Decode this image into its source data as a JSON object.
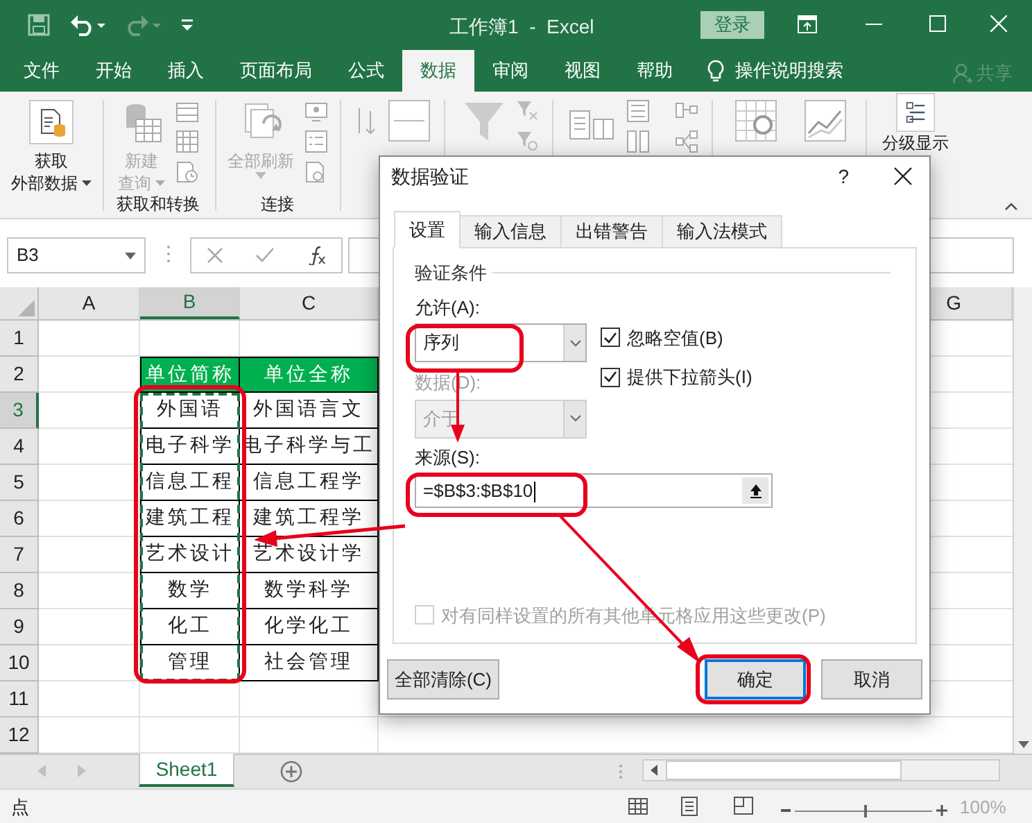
{
  "window": {
    "title": "工作簿1  -  Excel",
    "sign_in": "登录"
  },
  "ribbon_tabs": [
    {
      "label": "文件",
      "selected": false
    },
    {
      "label": "开始",
      "selected": false
    },
    {
      "label": "插入",
      "selected": false
    },
    {
      "label": "页面布局",
      "selected": false
    },
    {
      "label": "公式",
      "selected": false
    },
    {
      "label": "数据",
      "selected": true
    },
    {
      "label": "审阅",
      "selected": false
    },
    {
      "label": "视图",
      "selected": false
    },
    {
      "label": "帮助",
      "selected": false
    }
  ],
  "tell_me": "操作说明搜索",
  "share": "共享",
  "ribbon": {
    "get_external": [
      "获取",
      "外部数据"
    ],
    "new_query": [
      "新建",
      "查询"
    ],
    "refresh_all": "全部刷新",
    "groups": [
      "获取和转换",
      "连接"
    ],
    "outline": "分级显示"
  },
  "name_box": "B3",
  "columns": [
    "A",
    "B",
    "C",
    "G"
  ],
  "row_headers": [
    "1",
    "2",
    "3",
    "4",
    "5",
    "6",
    "7",
    "8",
    "9",
    "10",
    "11",
    "12"
  ],
  "table": {
    "header": [
      "单位简称",
      "单位全称"
    ],
    "rows": [
      [
        "外国语",
        "外国语言文"
      ],
      [
        "电子科学",
        "电子科学与工"
      ],
      [
        "信息工程",
        "信息工程学"
      ],
      [
        "建筑工程",
        "建筑工程学"
      ],
      [
        "艺术设计",
        "艺术设计学"
      ],
      [
        "数学",
        "数学科学"
      ],
      [
        "化工",
        "化学化工"
      ],
      [
        "管理",
        "社会管理"
      ]
    ]
  },
  "sheet_tabs": [
    {
      "label": "Sheet1",
      "selected": true
    }
  ],
  "status": {
    "mode": "点",
    "zoom": "100%",
    "zoom_slider": {
      "level": 0.5
    }
  },
  "dialog": {
    "title": "数据验证",
    "help": "?",
    "tabs": [
      {
        "label": "设置",
        "selected": true
      },
      {
        "label": "输入信息",
        "selected": false
      },
      {
        "label": "出错警告",
        "selected": false
      },
      {
        "label": "输入法模式",
        "selected": false
      }
    ],
    "section": "验证条件",
    "allow": {
      "label": "允许(A):",
      "value": "序列",
      "disabled": false
    },
    "data": {
      "label": "数据(D):",
      "value": "介于",
      "disabled": true
    },
    "checkboxes": [
      {
        "label": "忽略空值(B)",
        "checked": true
      },
      {
        "label": "提供下拉箭头(I)",
        "checked": true
      }
    ],
    "source": {
      "label": "来源(S):",
      "value": "=$B$3:$B$10"
    },
    "apply_all": {
      "label": "对有同样设置的所有其他单元格应用这些更改(P)",
      "checked": false,
      "disabled": true
    },
    "buttons": [
      {
        "label": "全部清除(C)",
        "default": false
      },
      {
        "label": "确定",
        "default": true
      },
      {
        "label": "取消",
        "default": false
      }
    ]
  }
}
